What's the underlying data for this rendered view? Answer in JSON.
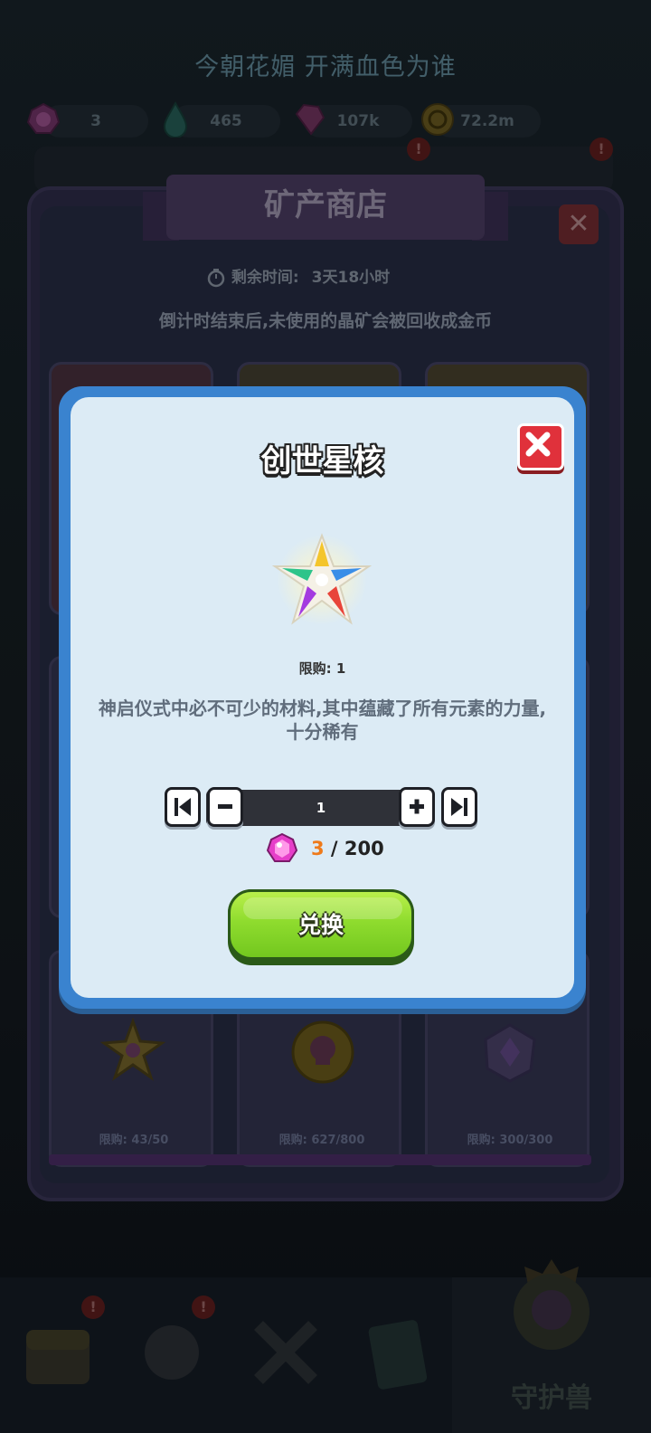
{
  "header": {
    "poem": "今朝花媚 开满血色为谁",
    "resources": [
      {
        "icon": "pink-gem-icon",
        "value": "3"
      },
      {
        "icon": "water-drop-icon",
        "value": "465"
      },
      {
        "icon": "pink-crystal-icon",
        "value": "107k"
      },
      {
        "icon": "gold-coin-icon",
        "value": "72.2m"
      }
    ]
  },
  "shop": {
    "title": "矿产商店",
    "timer_label": "剩余时间:",
    "timer_value": "3天18小时",
    "note": "倒计时结束后,未使用的晶矿会被回收成金币",
    "bottom_cards": [
      {
        "icon": "golden-star-key-icon",
        "limit": "限购: 43/50"
      },
      {
        "icon": "skull-coin-icon",
        "limit": "限购: 627/800"
      },
      {
        "icon": "purple-crystal-icon",
        "limit": "限购: 300/300"
      }
    ]
  },
  "modal": {
    "title": "创世星核",
    "item_icon": "rainbow-star-icon",
    "limit": "限购: 1",
    "description": "神启仪式中必不可少的材料,其中蕴藏了所有元素的力量,十分稀有",
    "quantity": "1",
    "cost_have": "3",
    "cost_sep": " / ",
    "cost_need": "200",
    "exchange_label": "兑换"
  },
  "bottom_nav": {
    "active_label": "守护兽"
  },
  "colors": {
    "modal_border": "#3a83cf",
    "modal_bg": "#dcebf5",
    "close_red": "#e0313b",
    "exchange_green": "#8fdc2e",
    "cost_have_orange": "#ef7a1a"
  }
}
